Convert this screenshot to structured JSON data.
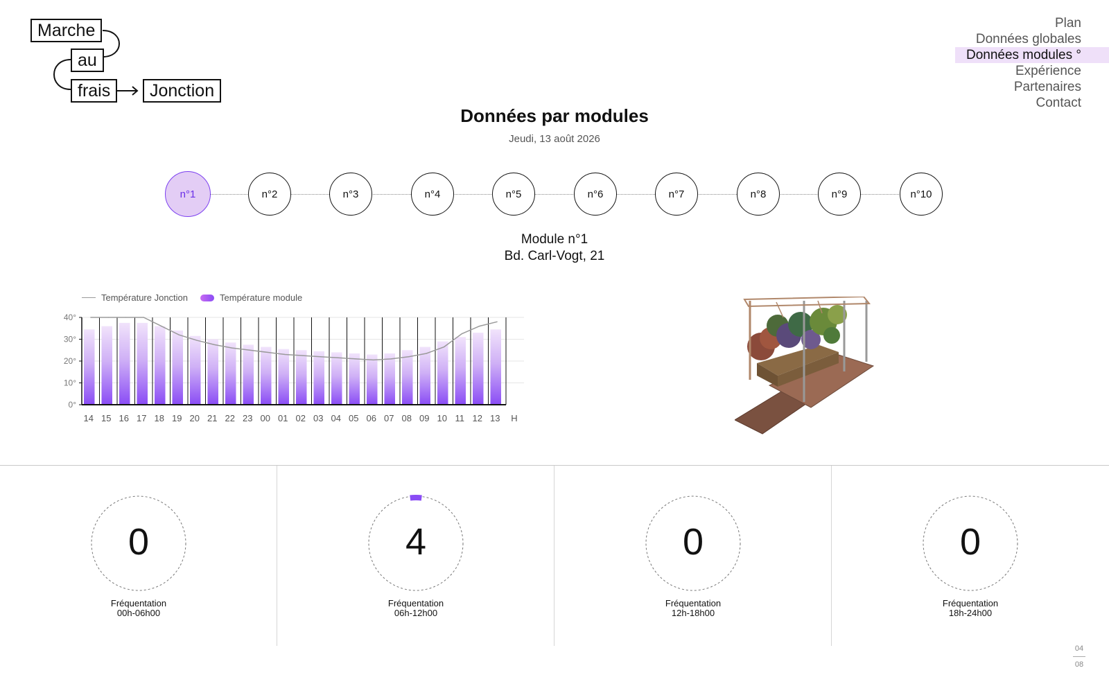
{
  "logo": {
    "word1": "Marche",
    "word2": "au",
    "word3": "frais",
    "word4": "Jonction"
  },
  "nav": {
    "items": [
      {
        "label": "Plan",
        "active": false
      },
      {
        "label": "Données globales",
        "active": false
      },
      {
        "label": "Données modules °",
        "active": true
      },
      {
        "label": "Expérience",
        "active": false
      },
      {
        "label": "Partenaires",
        "active": false
      },
      {
        "label": "Contact",
        "active": false
      }
    ]
  },
  "header": {
    "title": "Données par modules",
    "date": "Jeudi, 13 août 2026"
  },
  "modules": {
    "items": [
      "n°1",
      "n°2",
      "n°3",
      "n°4",
      "n°5",
      "n°6",
      "n°7",
      "n°8",
      "n°9",
      "n°10"
    ],
    "active_index": 0
  },
  "module_info": {
    "name": "Module n°1",
    "address": "Bd. Carl-Vogt, 21"
  },
  "colors": {
    "accent": "#8a4cf5",
    "accent_light": "#e3cdf5",
    "nav_active_bg": "#efe0f9"
  },
  "chart_data": {
    "type": "bar",
    "legend": {
      "line": "Température Jonction",
      "bar": "Température module"
    },
    "categories": [
      "14",
      "15",
      "16",
      "17",
      "18",
      "19",
      "20",
      "21",
      "22",
      "23",
      "00",
      "01",
      "02",
      "03",
      "04",
      "05",
      "06",
      "07",
      "08",
      "09",
      "10",
      "11",
      "12",
      "13"
    ],
    "x_unit": "H",
    "yticks": [
      "0°",
      "10°",
      "20°",
      "30°",
      "40°"
    ],
    "ylim": [
      0,
      40
    ],
    "grid": true,
    "series": [
      {
        "name": "Température module",
        "type": "bar",
        "values": [
          34.5,
          36,
          37.5,
          37.5,
          36,
          34,
          31.5,
          30,
          28.5,
          27.5,
          26.5,
          25.5,
          25,
          24.5,
          24,
          23.5,
          23,
          23.5,
          25,
          26.5,
          29,
          31,
          33,
          34.5
        ]
      },
      {
        "name": "Température Jonction",
        "type": "line",
        "values": [
          40,
          40,
          40,
          40,
          36,
          32,
          29.5,
          27.5,
          26,
          25,
          24,
          23,
          22.5,
          22,
          21.5,
          21,
          20.5,
          21,
          22,
          23.5,
          26.5,
          32.5,
          36,
          38
        ]
      }
    ]
  },
  "frequentation": [
    {
      "count": "0",
      "label": "Fréquentation",
      "range": "00h-06h00",
      "fill": 0
    },
    {
      "count": "4",
      "label": "Fréquentation",
      "range": "06h-12h00",
      "fill": 0.04
    },
    {
      "count": "0",
      "label": "Fréquentation",
      "range": "12h-18h00",
      "fill": 0
    },
    {
      "count": "0",
      "label": "Fréquentation",
      "range": "18h-24h00",
      "fill": 0
    }
  ],
  "pager": {
    "current": "04",
    "total": "08"
  }
}
